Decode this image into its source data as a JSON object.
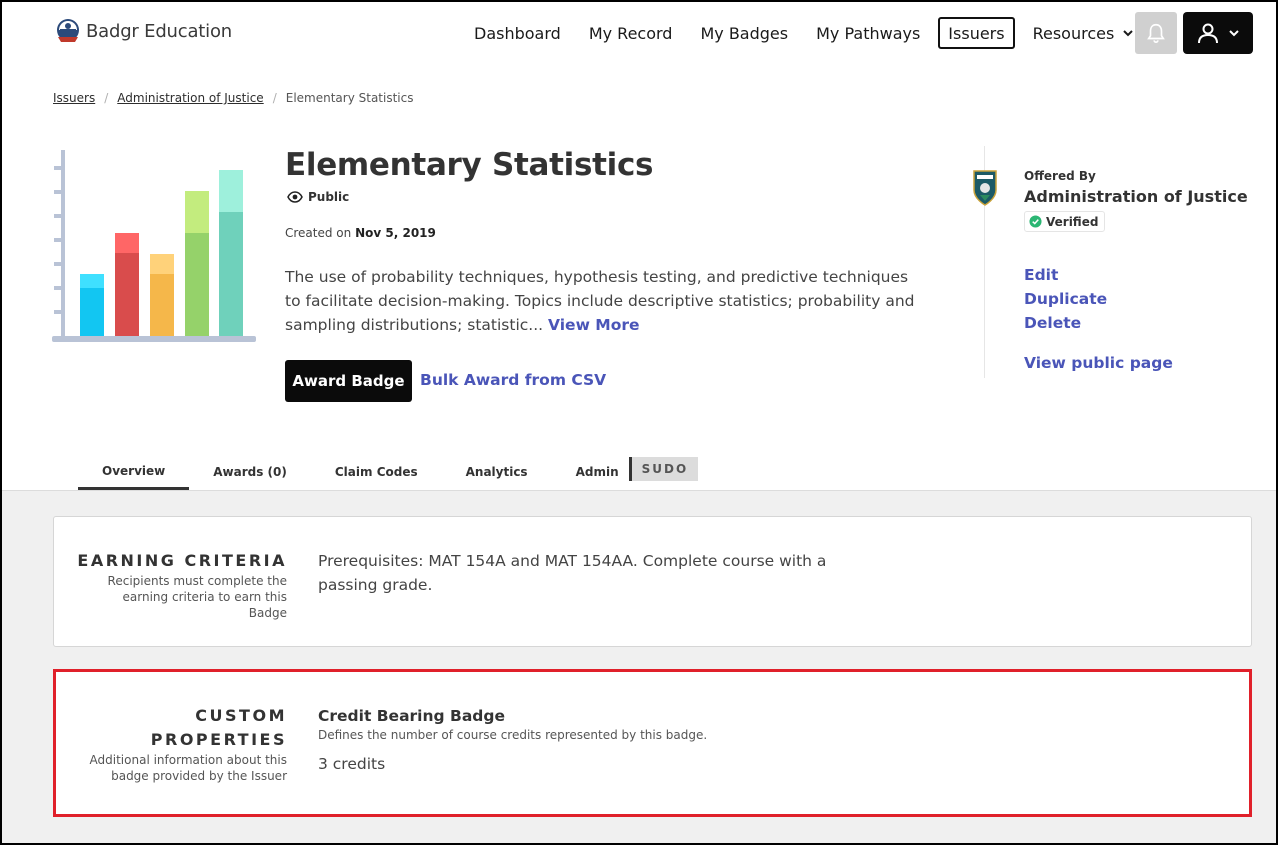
{
  "app": {
    "name": "Badgr Education"
  },
  "nav": {
    "items": [
      {
        "label": "Dashboard",
        "active": false
      },
      {
        "label": "My Record",
        "active": false
      },
      {
        "label": "My Badges",
        "active": false
      },
      {
        "label": "My Pathways",
        "active": false
      },
      {
        "label": "Issuers",
        "active": true
      },
      {
        "label": "Resources",
        "active": false
      }
    ]
  },
  "breadcrumb": {
    "items": [
      "Issuers",
      "Administration of Justice"
    ],
    "current": "Elementary Statistics",
    "separator": "/"
  },
  "badge": {
    "title": "Elementary Statistics",
    "visibility": "Public",
    "created_label": "Created on",
    "created_date": "Nov 5, 2019",
    "description": "The use of probability techniques, hypothesis testing, and predictive techniques to facilitate decision-making. Topics include descriptive statistics; probability and sampling distributions; statistic...",
    "view_more": "View More",
    "award_button": "Award Badge",
    "bulk_award": "Bulk Award from CSV"
  },
  "issuer": {
    "offered_by_label": "Offered By",
    "name": "Administration of Justice",
    "verified_label": "Verified",
    "actions": [
      "Edit",
      "Duplicate",
      "Delete"
    ],
    "public_page": "View public page"
  },
  "tabs": {
    "items": [
      "Overview",
      "Awards (0)",
      "Claim Codes",
      "Analytics",
      "Admin"
    ],
    "active_index": 0,
    "sudo": "SUDO"
  },
  "earning_criteria": {
    "heading": "EARNING CRITERIA",
    "subtitle": "Recipients must complete the earning criteria to earn this Badge",
    "text": "Prerequisites: MAT 154A and MAT 154AA. Complete course with a passing grade."
  },
  "custom_properties": {
    "heading_line1": "CUSTOM",
    "heading_line2": "PROPERTIES",
    "subtitle": "Additional information about this badge provided by the Issuer",
    "property_name": "Credit Bearing Badge",
    "property_description": "Defines the number of course credits represented by this badge.",
    "property_value": "3 credits"
  },
  "colors": {
    "accent_link": "#4a55b8",
    "button_dark": "#0b0b0b",
    "highlight_border": "#e0202a",
    "verified_green": "#2bb673"
  },
  "icons": [
    "badgr-logo",
    "chevron-down-icon",
    "bell-icon",
    "user-icon",
    "eye-icon",
    "check-circle-icon",
    "bar-chart-badge-image",
    "issuer-shield-logo"
  ]
}
